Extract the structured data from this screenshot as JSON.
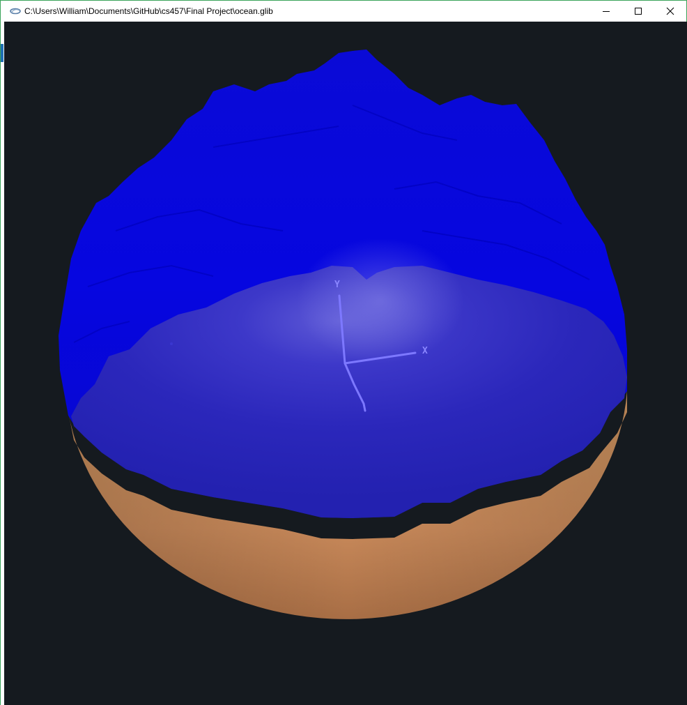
{
  "window": {
    "title": "C:\\Users\\William\\Documents\\GitHub\\cs457\\Final Project\\ocean.glib",
    "app_icon": "glman-icon",
    "controls": {
      "minimize_icon": "minimize-icon",
      "maximize_icon": "maximize-icon",
      "close_icon": "close-icon"
    }
  },
  "scene": {
    "background_color": "#151a1f",
    "ocean_color": "#0a0ad8",
    "ocean_inner_color": "#2a28c0",
    "sand_color": "#c98c5a",
    "axes": {
      "x_label": "X",
      "y_label": "Y",
      "color": "#7d78ff"
    }
  }
}
